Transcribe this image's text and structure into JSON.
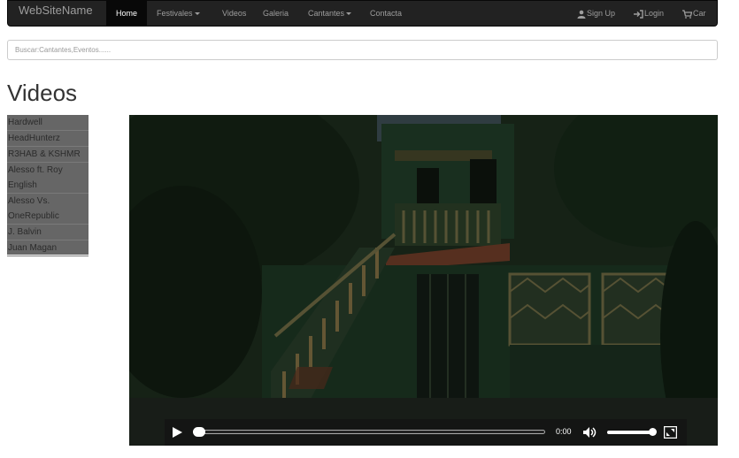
{
  "navbar": {
    "brand": "WebSiteName",
    "items": [
      {
        "label": "Home",
        "active": true
      },
      {
        "label": "Festivales",
        "dropdown": true
      },
      {
        "label": "Videos"
      },
      {
        "label": "Galeria"
      },
      {
        "label": "Cantantes",
        "dropdown": true
      },
      {
        "label": "Contacta"
      }
    ],
    "right": [
      {
        "label": "Sign Up",
        "icon": "user-icon"
      },
      {
        "label": "Login",
        "icon": "login-icon"
      },
      {
        "label": "Car",
        "icon": "cart-icon"
      }
    ]
  },
  "search": {
    "placeholder": "Buscar:Cantantes,Eventos......",
    "value": ""
  },
  "page": {
    "title": "Videos"
  },
  "sidebar": {
    "items": [
      {
        "label": "Hardwell"
      },
      {
        "label": "HeadHunterz"
      },
      {
        "label": "R3HAB & KSHMR"
      },
      {
        "label": "Alesso ft. Roy English"
      },
      {
        "label": "Alesso Vs. OneRepublic"
      },
      {
        "label": "J. Balvin"
      },
      {
        "label": "Juan Magan"
      }
    ]
  },
  "video": {
    "current_time": "0:00",
    "progress": 0,
    "volume": 1,
    "icons": [
      "play-icon",
      "volume-icon",
      "fullscreen-icon"
    ]
  },
  "colors": {
    "navbar_bg": "#222222",
    "navbar_text": "#9d9d9d",
    "sidebar_bg": "#666666"
  }
}
